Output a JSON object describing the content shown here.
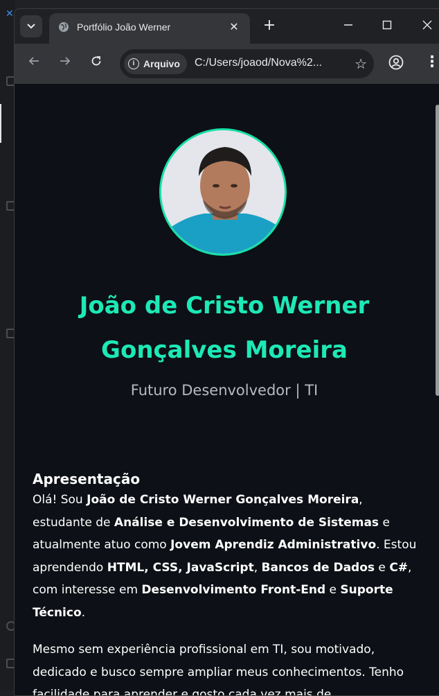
{
  "tab": {
    "title": "Portfólio João Werner"
  },
  "toolbar": {
    "chip_label": "Arquivo",
    "url": "C:/Users/joaod/Nova%2..."
  },
  "page": {
    "name": "João de Cristo Werner Gonçalves Moreira",
    "subtitle": "Futuro Desenvolvedor | TI",
    "section_title": "Apresentação",
    "para1": {
      "t1": "Olá! Sou ",
      "b1": "João de Cristo Werner Gonçalves Moreira",
      "t2": ", estudante de ",
      "b2": "Análise e Desenvolvimento de Sistemas",
      "t3": " e atualmente atuo como ",
      "b3": "Jovem Aprendiz Administrativo",
      "t4": ". Estou aprendendo ",
      "b4": "HTML, CSS, JavaScript",
      "t5": ", ",
      "b5": "Bancos de Dados",
      "t6": " e ",
      "b6": "C#",
      "t7": ", com interesse em ",
      "b7": "Desenvolvimento Front-End",
      "t8": " e ",
      "b8": "Suporte Técnico",
      "t9": "."
    },
    "para2": "Mesmo sem experiência profissional em TI, sou motivado, dedicado e busco sempre ampliar meus conhecimentos. Tenho facilidade para aprender e gosto cada vez mais de"
  },
  "colors": {
    "accent": "#1de9b6",
    "page_bg": "#0d1016",
    "chrome_bg": "#35363a"
  }
}
